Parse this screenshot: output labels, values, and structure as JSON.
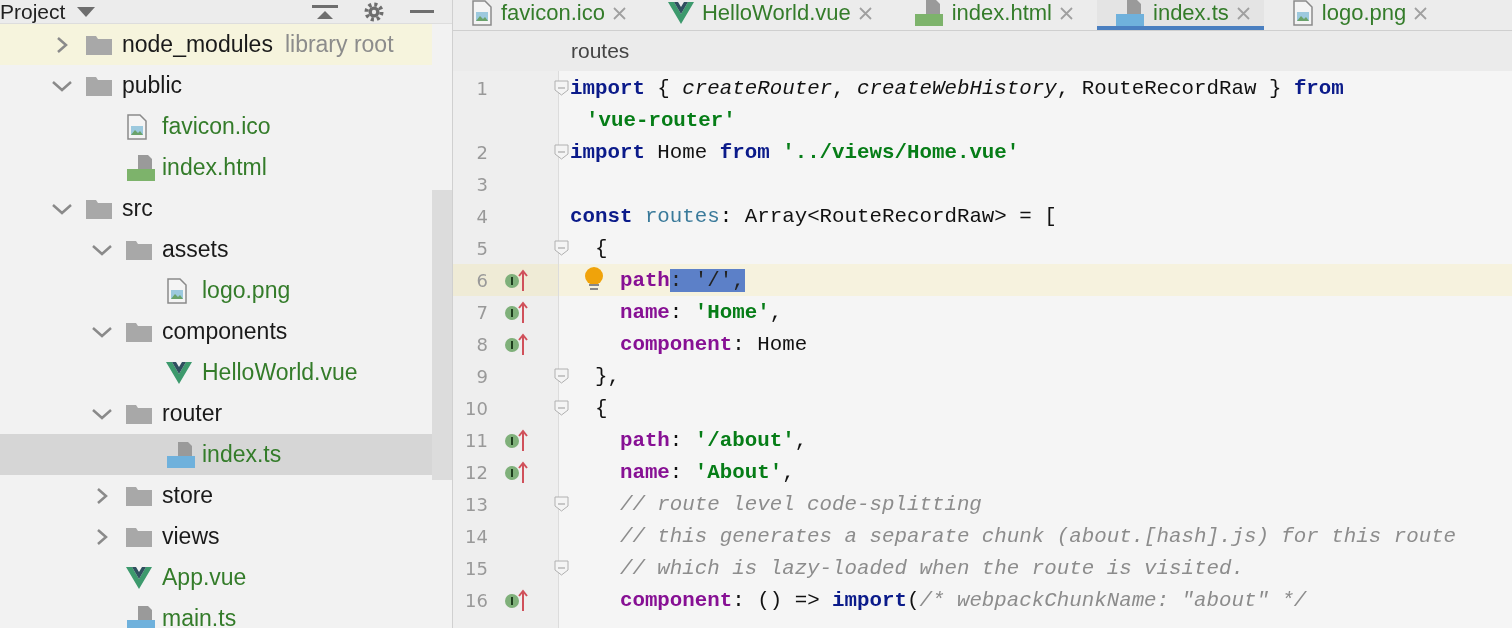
{
  "project_panel": {
    "title": "Project",
    "tree": [
      {
        "label": "node_modules",
        "note": "library root",
        "kind": "folder",
        "library": true,
        "expanded": false,
        "selected": false,
        "added": false
      },
      {
        "label": "public",
        "kind": "folder",
        "library": false,
        "expanded": true,
        "selected": false,
        "added": false,
        "children": [
          {
            "label": "favicon.ico",
            "kind": "image",
            "selected": false,
            "added": true
          },
          {
            "label": "index.html",
            "kind": "html",
            "selected": false,
            "added": true
          }
        ]
      },
      {
        "label": "src",
        "kind": "folder",
        "library": false,
        "expanded": true,
        "selected": false,
        "added": false,
        "children": [
          {
            "label": "assets",
            "kind": "folder",
            "expanded": true,
            "selected": false,
            "added": false,
            "children": [
              {
                "label": "logo.png",
                "kind": "image",
                "selected": false,
                "added": true
              }
            ]
          },
          {
            "label": "components",
            "kind": "folder",
            "expanded": true,
            "selected": false,
            "added": false,
            "children": [
              {
                "label": "HelloWorld.vue",
                "kind": "vue",
                "selected": false,
                "added": true
              }
            ]
          },
          {
            "label": "router",
            "kind": "folder",
            "expanded": true,
            "selected": false,
            "added": false,
            "children": [
              {
                "label": "index.ts",
                "kind": "ts",
                "selected": true,
                "added": true
              }
            ]
          },
          {
            "label": "store",
            "kind": "folder",
            "expanded": false,
            "selected": false,
            "added": false
          },
          {
            "label": "views",
            "kind": "folder",
            "expanded": false,
            "selected": false,
            "added": false
          },
          {
            "label": "App.vue",
            "kind": "vue",
            "selected": false,
            "added": true
          },
          {
            "label": "main.ts",
            "kind": "ts",
            "selected": false,
            "added": true
          }
        ]
      }
    ]
  },
  "tabs": [
    {
      "label": "favicon.ico",
      "kind": "image",
      "selected": false
    },
    {
      "label": "HelloWorld.vue",
      "kind": "vue",
      "selected": false
    },
    {
      "label": "index.html",
      "kind": "html",
      "selected": false
    },
    {
      "label": "index.ts",
      "kind": "ts",
      "selected": true
    },
    {
      "label": "logo.png",
      "kind": "image",
      "selected": false
    }
  ],
  "breadcrumb": "routes",
  "code": [
    {
      "kind": "line",
      "number": "1",
      "fold": true,
      "marker": false,
      "current": false,
      "bulb": false,
      "tokens": [
        {
          "t": "import",
          "kind": "kw"
        },
        {
          "t": " { ",
          "kind": "text"
        },
        {
          "t": "createRouter",
          "kind": "fn"
        },
        {
          "t": ", ",
          "kind": "text"
        },
        {
          "t": "createWebHistory",
          "kind": "fn"
        },
        {
          "t": ", RouteRecordRaw } ",
          "kind": "text"
        },
        {
          "t": "from",
          "kind": "kw"
        }
      ]
    },
    {
      "kind": "wrap",
      "tokens": [
        {
          "t": "'vue-router'",
          "kind": "str"
        }
      ]
    },
    {
      "kind": "line",
      "number": "2",
      "fold": true,
      "marker": false,
      "current": false,
      "bulb": false,
      "tokens": [
        {
          "t": "import",
          "kind": "kw"
        },
        {
          "t": " Home ",
          "kind": "text"
        },
        {
          "t": "from",
          "kind": "kw"
        },
        {
          "t": " '../views/Home.vue'",
          "kind": "str"
        }
      ]
    },
    {
      "kind": "line",
      "number": "3",
      "fold": false,
      "marker": false,
      "current": false,
      "bulb": false
    },
    {
      "kind": "line",
      "number": "4",
      "fold": false,
      "marker": false,
      "current": false,
      "bulb": false,
      "tokens": [
        {
          "t": "const",
          "kind": "kw"
        },
        {
          "t": " routes",
          "kind": "var"
        },
        {
          "t": ": Array<RouteRecordRaw> = [",
          "kind": "text"
        }
      ]
    },
    {
      "kind": "line",
      "number": "5",
      "fold": true,
      "marker": false,
      "current": false,
      "bulb": false,
      "tokens": [
        {
          "t": "  {",
          "kind": "text"
        }
      ]
    },
    {
      "kind": "line",
      "number": "6",
      "fold": false,
      "marker": true,
      "current": true,
      "bulb": true,
      "tokens": [
        {
          "t": "    path",
          "kind": "prop"
        },
        {
          "t": ": '/',",
          "kind": "sel"
        }
      ]
    },
    {
      "kind": "line",
      "number": "7",
      "fold": false,
      "marker": true,
      "current": false,
      "bulb": false,
      "tokens": [
        {
          "t": "    name",
          "kind": "prop"
        },
        {
          "t": ": ",
          "kind": "text"
        },
        {
          "t": "'Home'",
          "kind": "str"
        },
        {
          "t": ",",
          "kind": "text"
        }
      ]
    },
    {
      "kind": "line",
      "number": "8",
      "fold": false,
      "marker": true,
      "current": false,
      "bulb": false,
      "tokens": [
        {
          "t": "    component",
          "kind": "prop"
        },
        {
          "t": ": Home",
          "kind": "text"
        }
      ]
    },
    {
      "kind": "line",
      "number": "9",
      "fold": true,
      "marker": false,
      "current": false,
      "bulb": false,
      "tokens": [
        {
          "t": "  },",
          "kind": "text"
        }
      ]
    },
    {
      "kind": "line",
      "number": "10",
      "fold": true,
      "marker": false,
      "current": false,
      "bulb": false,
      "tokens": [
        {
          "t": "  {",
          "kind": "text"
        }
      ]
    },
    {
      "kind": "line",
      "number": "11",
      "fold": false,
      "marker": true,
      "current": false,
      "bulb": false,
      "tokens": [
        {
          "t": "    path",
          "kind": "prop"
        },
        {
          "t": ": ",
          "kind": "text"
        },
        {
          "t": "'/about'",
          "kind": "str"
        },
        {
          "t": ",",
          "kind": "text"
        }
      ]
    },
    {
      "kind": "line",
      "number": "12",
      "fold": false,
      "marker": true,
      "current": false,
      "bulb": false,
      "tokens": [
        {
          "t": "    name",
          "kind": "prop"
        },
        {
          "t": ": ",
          "kind": "text"
        },
        {
          "t": "'About'",
          "kind": "str"
        },
        {
          "t": ",",
          "kind": "text"
        }
      ]
    },
    {
      "kind": "line",
      "number": "13",
      "fold": true,
      "marker": false,
      "current": false,
      "bulb": false,
      "tokens": [
        {
          "t": "    // route level code-splitting",
          "kind": "comment"
        }
      ]
    },
    {
      "kind": "line",
      "number": "14",
      "fold": false,
      "marker": false,
      "current": false,
      "bulb": false,
      "tokens": [
        {
          "t": "    // this generates a separate chunk (about.[hash].js) for this route",
          "kind": "comment"
        }
      ]
    },
    {
      "kind": "line",
      "number": "15",
      "fold": true,
      "marker": false,
      "current": false,
      "bulb": false,
      "tokens": [
        {
          "t": "    // which is lazy-loaded when the route is visited.",
          "kind": "comment"
        }
      ]
    },
    {
      "kind": "line",
      "number": "16",
      "fold": false,
      "marker": true,
      "current": false,
      "bulb": false,
      "tokens": [
        {
          "t": "    component",
          "kind": "prop"
        },
        {
          "t": ": () => ",
          "kind": "text"
        },
        {
          "t": "import",
          "kind": "kw"
        },
        {
          "t": "(",
          "kind": "text"
        },
        {
          "t": "/* webpackChunkName: \"about\" */",
          "kind": "comment"
        }
      ]
    }
  ]
}
